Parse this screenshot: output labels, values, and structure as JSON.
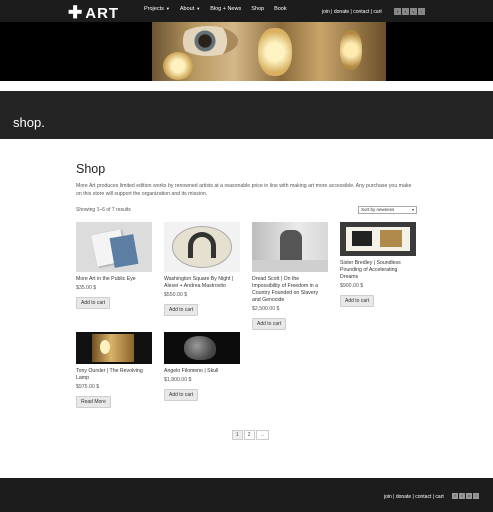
{
  "nav": {
    "logo": "ART",
    "links": [
      {
        "label": "Projects",
        "dropdown": true
      },
      {
        "label": "About",
        "dropdown": true
      },
      {
        "label": "Blog + News",
        "dropdown": false
      },
      {
        "label": "Shop",
        "dropdown": false
      },
      {
        "label": "Book",
        "dropdown": false
      }
    ],
    "utility": "join | donate | contact | cart",
    "social": [
      "f",
      "t",
      "v",
      "i"
    ]
  },
  "band_title": "shop.",
  "main": {
    "title": "Shop",
    "intro": "More Art produces limited edition works by renowned artists at a reasonable price in line with making art more accessible. Any purchase you make on this store will support the organization and its mission.",
    "result_count": "Showing 1–6 of 7 results",
    "sort_selected": "Sort by newness"
  },
  "products": [
    {
      "name": "More Art in the Public Eye",
      "price": "$35.00 $",
      "button": "Add to cart"
    },
    {
      "name": "Washington Square By Night | Alexei + Andrea Mastrovito",
      "price": "$550.00 $",
      "button": "Add to cart"
    },
    {
      "name": "Dread Scott | On the Impossibility of Freedom in a Country Founded on Slavery and Genocide",
      "price": "$2,500.00 $",
      "button": "Add to cart"
    },
    {
      "name": "Sister Bredley | Soundless Pounding of Accelerating Dreams",
      "price": "$900.00 $",
      "button": "Add to cart"
    },
    {
      "name": "Tony Oursler | The Revolving Lamp",
      "price": "$975.00 $",
      "button": "Read More"
    },
    {
      "name": "Angelo Filomeno | Skull",
      "price": "$1,800.00 $",
      "button": "Add to cart"
    }
  ],
  "pagination": {
    "pages": [
      "1",
      "2"
    ],
    "next": "→",
    "current": "1"
  },
  "footer": {
    "links": "join | donate | contact | cart",
    "social": [
      "f",
      "t",
      "v",
      "i"
    ]
  }
}
